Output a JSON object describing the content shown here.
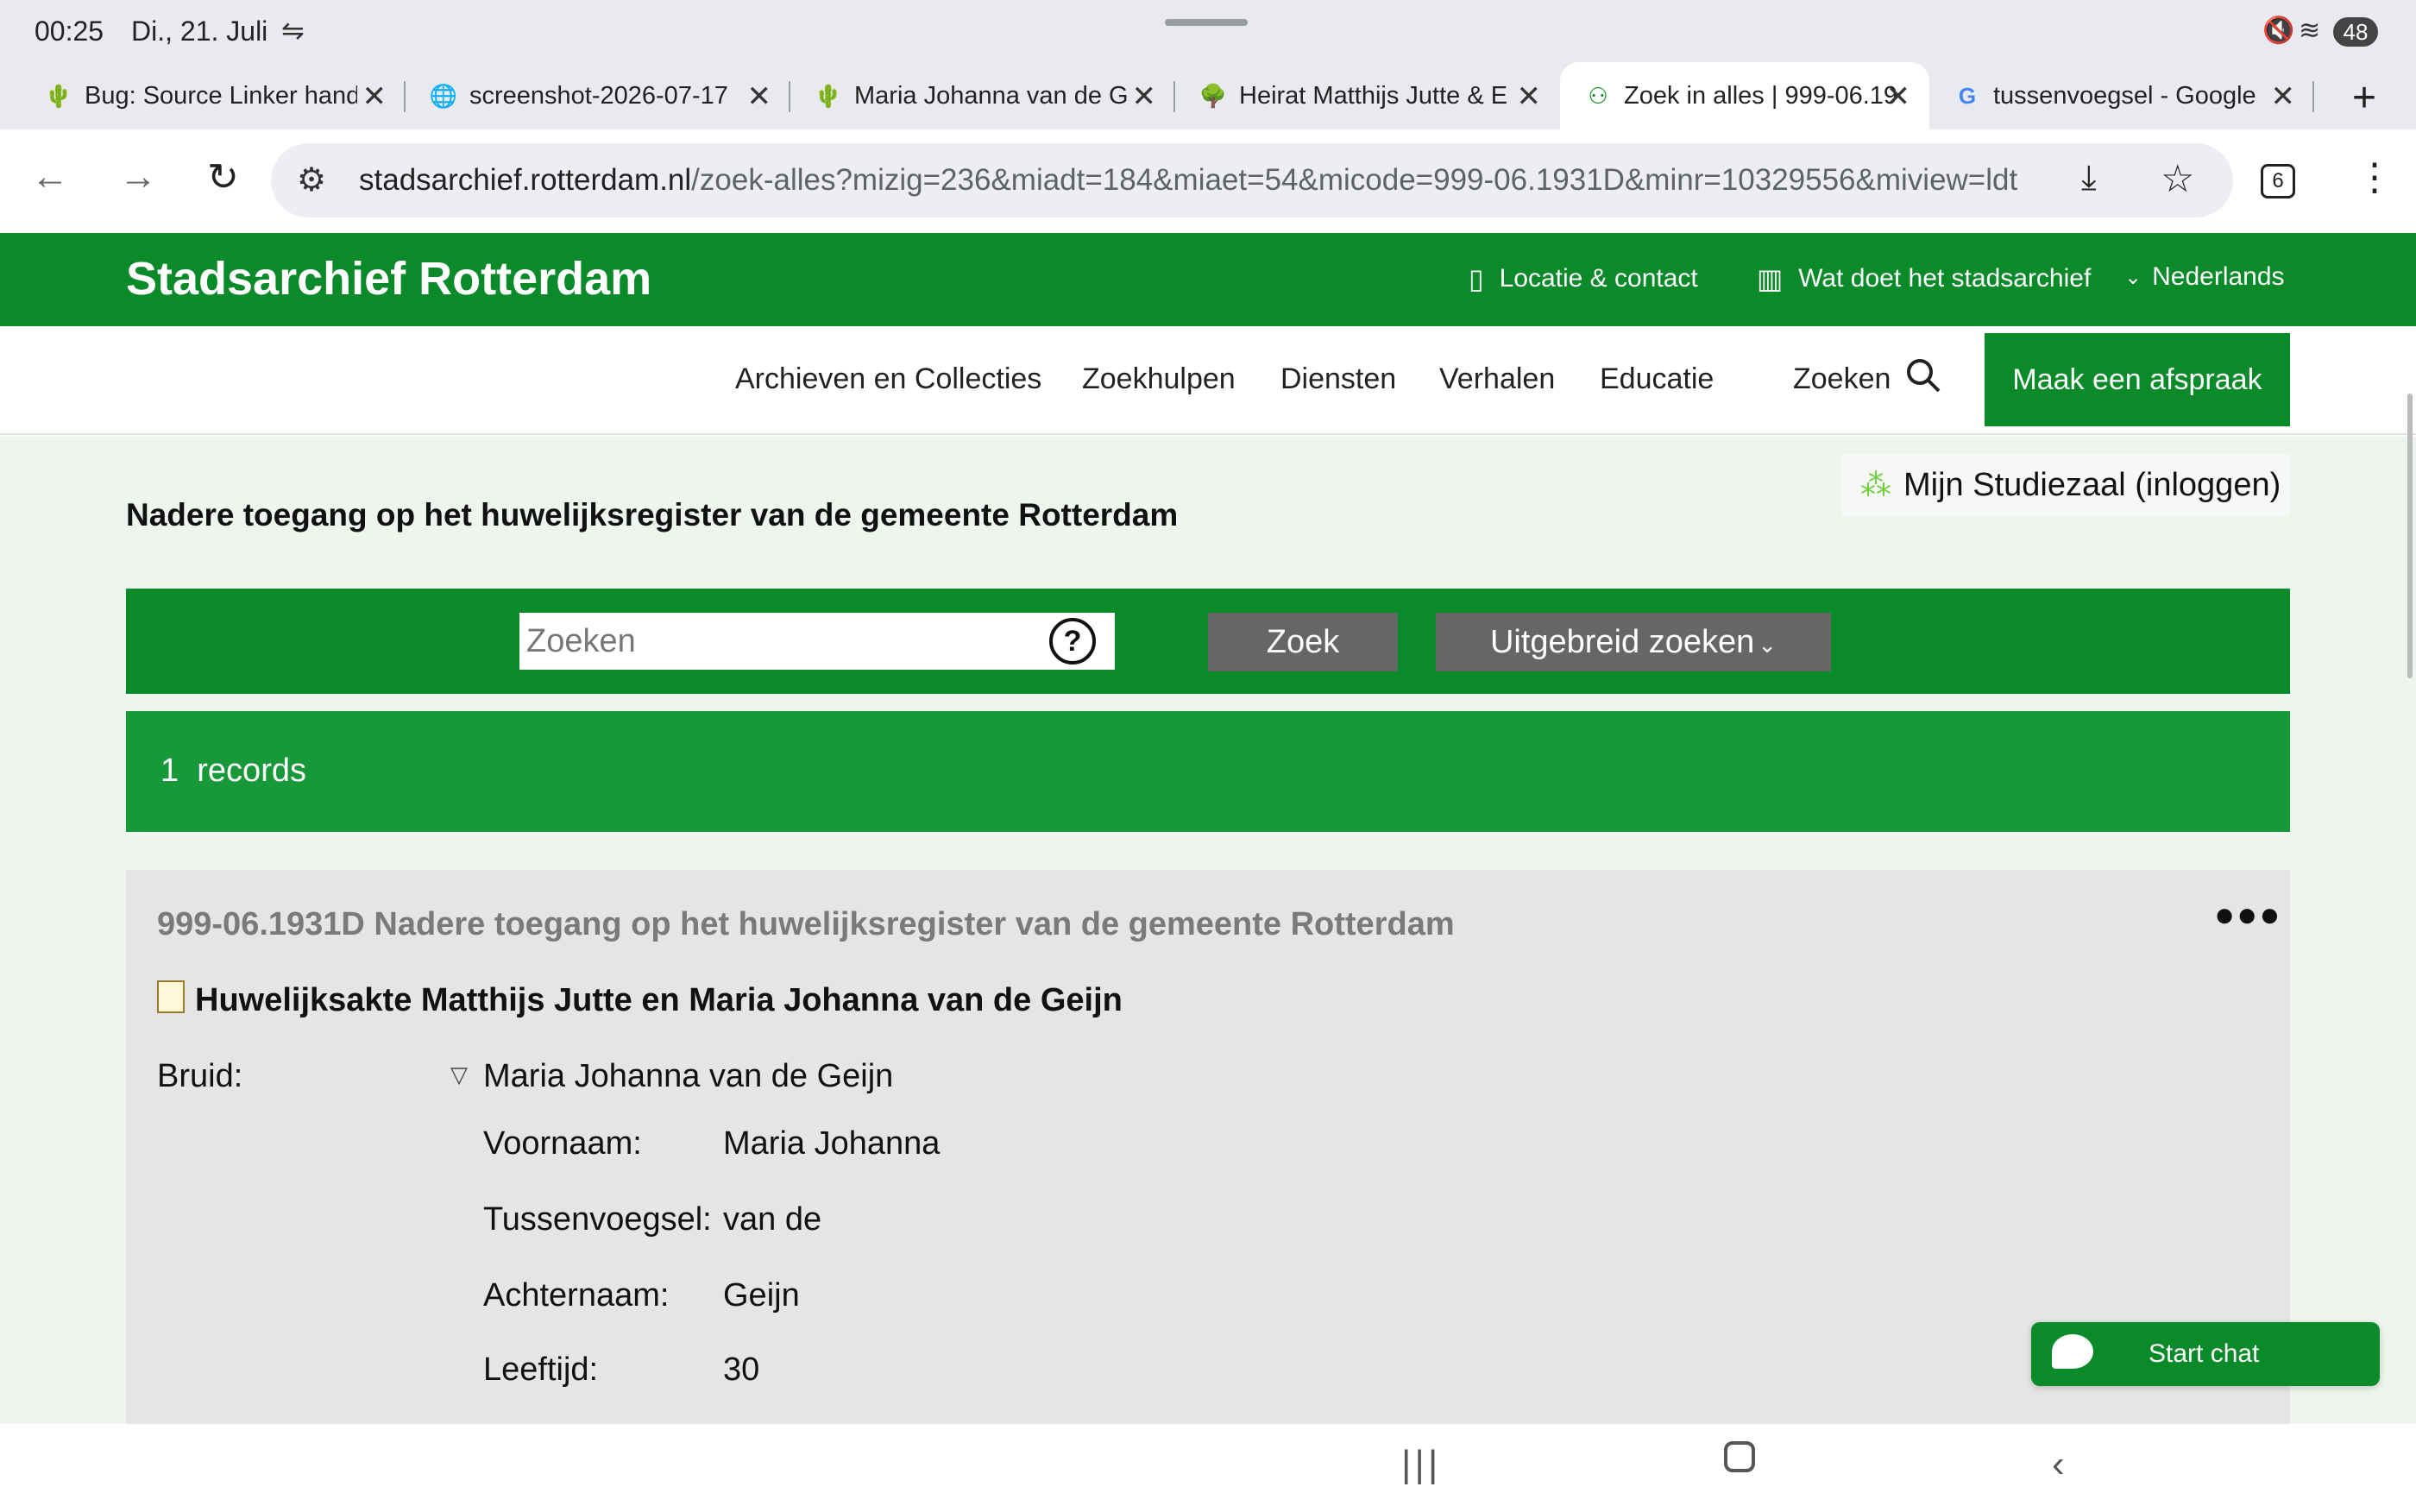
{
  "status": {
    "time": "00:25",
    "date": "Di., 21. Juli",
    "battery": "48"
  },
  "tabs": [
    {
      "title": "Bug: Source Linker hand",
      "fav": "🌵"
    },
    {
      "title": "screenshot-2026-07-17",
      "fav": "🌐"
    },
    {
      "title": "Maria Johanna van de G",
      "fav": "🌵"
    },
    {
      "title": "Heirat Matthijs Jutte & E",
      "fav": "🌳"
    },
    {
      "title": "Zoek in alles | 999-06.19",
      "fav": "⚇"
    },
    {
      "title": "tussenvoegsel - Google",
      "fav": "G"
    }
  ],
  "address": {
    "host": "stadsarchief.rotterdam.nl",
    "path": "/zoek-alles?mizig=236&miadt=184&miaet=54&micode=999-06.1931D&minr=10329556&miview=ldt",
    "tab_count": "6"
  },
  "site": {
    "brand": "Stadsarchief Rotterdam",
    "util_locatie": "Locatie & contact",
    "util_watdoet": "Wat doet het stadsarchief",
    "util_lang": "Nederlands",
    "nav": [
      "Archieven en Collecties",
      "Zoekhulpen",
      "Diensten",
      "Verhalen",
      "Educatie"
    ],
    "nav_zoeken": "Zoeken",
    "cta": "Maak een afspraak"
  },
  "page": {
    "studiezaal": "Mijn Studiezaal (inloggen)",
    "title": "Nadere toegang op het huwelijksregister van de gemeente Rotterdam",
    "search_placeholder": "Zoeken",
    "search_button": "Zoek",
    "advanced_button": "Uitgebreid zoeken",
    "records_count": "1",
    "records_label": "records"
  },
  "record": {
    "reference": "999-06.1931D Nadere toegang op het huwelijksregister van de gemeente Rotterdam",
    "doc_title": "Huwelijksakte Matthijs Jutte en Maria Johanna van de Geijn",
    "bruid_label": "Bruid:",
    "bruid_name": "Maria Johanna van de Geijn",
    "fields": [
      {
        "label": "Voornaam:",
        "value": "Maria Johanna"
      },
      {
        "label": "Tussenvoegsel:",
        "value": "van de"
      },
      {
        "label": "Achternaam:",
        "value": "Geijn"
      },
      {
        "label": "Leeftijd:",
        "value": "30"
      }
    ]
  },
  "chat": {
    "label": "Start chat"
  },
  "colors": {
    "brand_green": "#0a8a28",
    "records_green": "#17993a",
    "button_grey": "#666666"
  }
}
